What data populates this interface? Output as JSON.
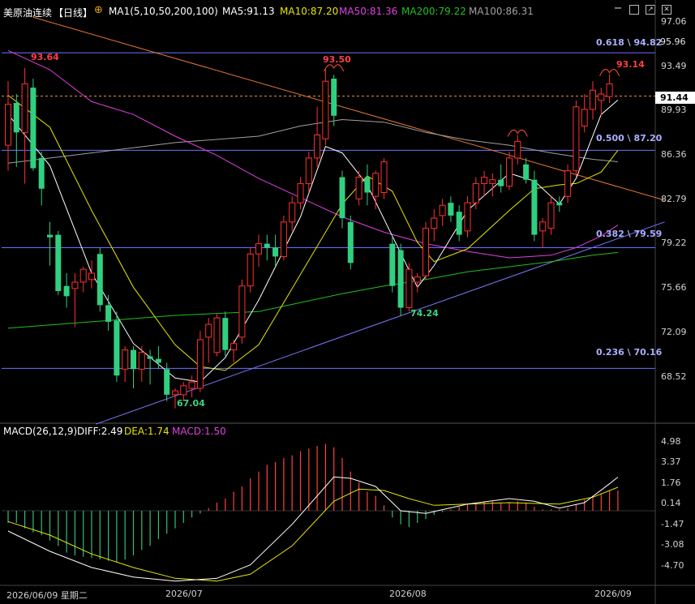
{
  "header": {
    "title": "美原油连续",
    "period": "【日线】",
    "ma_label": "MA1(5,10,50,200,100)",
    "ma5": "MA5:91.13",
    "ma10": "MA10:87.20",
    "ma50": "MA50:81.36",
    "ma200": "MA200:79.22",
    "ma100": "MA100:86.31",
    "colors": {
      "ma5": "#ffffff",
      "ma10": "#e6e600",
      "ma50": "#e040e0",
      "ma200": "#20c020",
      "ma100": "#a0a0a0"
    }
  },
  "macd_header": {
    "label": "MACD(26,12,9)",
    "diff": "DIFF:2.49",
    "dea": "DEA:1.74",
    "macd": "MACD:1.50"
  },
  "price_axis": [
    "97.06",
    "95.96",
    "93.49",
    "89.93",
    "86.36",
    "82.79",
    "79.22",
    "75.66",
    "72.09",
    "68.52"
  ],
  "price_tags": {
    "last": "91.44",
    "prev": "95.96"
  },
  "macd_axis": [
    "4.98",
    "3.37",
    "1.76",
    "0.14",
    "-1.47",
    "-3.08",
    "-4.70"
  ],
  "x_axis": [
    "2026/06/09 星期二",
    "2026/07",
    "2026/08",
    "2026/09"
  ],
  "annotations": {
    "high1": "93.64",
    "high2": "93.50",
    "high3": "93.14",
    "low1": "67.04",
    "low2": "74.24"
  },
  "fib_levels": [
    {
      "label": "0.618 \\ 94.82",
      "value": 94.82
    },
    {
      "label": "0.500 \\ 87.20",
      "value": 87.2
    },
    {
      "label": "0.382 \\ 79.59",
      "value": 79.59
    },
    {
      "label": "0.236 \\ 70.16",
      "value": 70.16
    }
  ],
  "chart_data": {
    "type": "candlestick",
    "title": "美原油连续【日线】",
    "ylim": [
      66.0,
      97.3
    ],
    "candles": [
      {
        "o": 87.6,
        "h": 92.6,
        "l": 85.6,
        "c": 90.8
      },
      {
        "o": 90.9,
        "h": 91.6,
        "l": 85.9,
        "c": 88.6
      },
      {
        "o": 88.6,
        "h": 93.64,
        "l": 84.6,
        "c": 92.4
      },
      {
        "o": 92.1,
        "h": 92.8,
        "l": 85.6,
        "c": 85.8
      },
      {
        "o": 86.6,
        "h": 87.1,
        "l": 82.9,
        "c": 84.2
      },
      {
        "o": 80.6,
        "h": 81.6,
        "l": 78.2,
        "c": 80.4
      },
      {
        "o": 80.6,
        "h": 80.9,
        "l": 75.9,
        "c": 76.2
      },
      {
        "o": 76.6,
        "h": 77.6,
        "l": 74.9,
        "c": 75.8
      },
      {
        "o": 76.4,
        "h": 77.6,
        "l": 73.4,
        "c": 76.9
      },
      {
        "o": 76.9,
        "h": 78.1,
        "l": 76.1,
        "c": 77.9
      },
      {
        "o": 77.1,
        "h": 78.6,
        "l": 76.4,
        "c": 77.6
      },
      {
        "o": 79.1,
        "h": 79.6,
        "l": 74.6,
        "c": 75.1
      },
      {
        "o": 75.1,
        "h": 75.9,
        "l": 73.1,
        "c": 73.8
      },
      {
        "o": 73.9,
        "h": 74.6,
        "l": 69.1,
        "c": 69.6
      },
      {
        "o": 70.1,
        "h": 71.9,
        "l": 69.1,
        "c": 71.6
      },
      {
        "o": 71.6,
        "h": 71.9,
        "l": 68.6,
        "c": 70.1
      },
      {
        "o": 70.1,
        "h": 71.9,
        "l": 69.1,
        "c": 71.4
      },
      {
        "o": 71.1,
        "h": 71.6,
        "l": 68.9,
        "c": 70.9
      },
      {
        "o": 70.9,
        "h": 71.9,
        "l": 70.1,
        "c": 70.6
      },
      {
        "o": 70.1,
        "h": 70.6,
        "l": 67.6,
        "c": 68.1
      },
      {
        "o": 68.1,
        "h": 68.6,
        "l": 67.04,
        "c": 68.4
      },
      {
        "o": 68.1,
        "h": 69.1,
        "l": 67.6,
        "c": 68.8
      },
      {
        "o": 68.6,
        "h": 69.6,
        "l": 67.9,
        "c": 69.1
      },
      {
        "o": 68.6,
        "h": 73.1,
        "l": 68.3,
        "c": 72.4
      },
      {
        "o": 72.6,
        "h": 74.1,
        "l": 70.6,
        "c": 73.6
      },
      {
        "o": 71.4,
        "h": 74.4,
        "l": 71.1,
        "c": 74.1
      },
      {
        "o": 74.1,
        "h": 74.6,
        "l": 71.1,
        "c": 71.6
      },
      {
        "o": 71.6,
        "h": 72.4,
        "l": 70.6,
        "c": 72.1
      },
      {
        "o": 72.6,
        "h": 77.1,
        "l": 72.1,
        "c": 76.6
      },
      {
        "o": 76.6,
        "h": 79.6,
        "l": 76.1,
        "c": 79.1
      },
      {
        "o": 79.1,
        "h": 80.6,
        "l": 78.1,
        "c": 79.9
      },
      {
        "o": 79.9,
        "h": 80.6,
        "l": 78.6,
        "c": 79.6
      },
      {
        "o": 79.6,
        "h": 80.6,
        "l": 78.1,
        "c": 78.9
      },
      {
        "o": 78.9,
        "h": 82.1,
        "l": 78.6,
        "c": 81.6
      },
      {
        "o": 81.6,
        "h": 83.6,
        "l": 80.9,
        "c": 83.1
      },
      {
        "o": 83.1,
        "h": 85.1,
        "l": 82.6,
        "c": 84.6
      },
      {
        "o": 84.6,
        "h": 87.1,
        "l": 83.9,
        "c": 86.6
      },
      {
        "o": 86.6,
        "h": 90.6,
        "l": 85.9,
        "c": 88.4
      },
      {
        "o": 88.1,
        "h": 93.5,
        "l": 87.6,
        "c": 92.6
      },
      {
        "o": 92.8,
        "h": 93.1,
        "l": 89.1,
        "c": 89.9
      },
      {
        "o": 85.1,
        "h": 85.6,
        "l": 81.1,
        "c": 81.9
      },
      {
        "o": 81.6,
        "h": 82.1,
        "l": 77.9,
        "c": 78.4
      },
      {
        "o": 83.4,
        "h": 85.6,
        "l": 82.9,
        "c": 85.1
      },
      {
        "o": 85.1,
        "h": 86.1,
        "l": 82.9,
        "c": 83.9
      },
      {
        "o": 83.6,
        "h": 85.6,
        "l": 82.6,
        "c": 85.4
      },
      {
        "o": 83.9,
        "h": 86.6,
        "l": 83.4,
        "c": 86.3
      },
      {
        "o": 79.9,
        "h": 80.6,
        "l": 76.1,
        "c": 76.6
      },
      {
        "o": 79.4,
        "h": 79.9,
        "l": 74.24,
        "c": 74.9
      },
      {
        "o": 74.9,
        "h": 78.4,
        "l": 74.6,
        "c": 77.9
      },
      {
        "o": 76.9,
        "h": 77.6,
        "l": 76.1,
        "c": 77.3
      },
      {
        "o": 77.4,
        "h": 81.6,
        "l": 77.1,
        "c": 81.1
      },
      {
        "o": 81.1,
        "h": 82.6,
        "l": 80.1,
        "c": 81.9
      },
      {
        "o": 82.1,
        "h": 83.4,
        "l": 81.3,
        "c": 82.9
      },
      {
        "o": 83.1,
        "h": 83.6,
        "l": 81.6,
        "c": 82.1
      },
      {
        "o": 82.4,
        "h": 82.9,
        "l": 80.1,
        "c": 80.6
      },
      {
        "o": 80.9,
        "h": 83.6,
        "l": 80.4,
        "c": 83.1
      },
      {
        "o": 83.1,
        "h": 85.1,
        "l": 82.6,
        "c": 84.6
      },
      {
        "o": 84.6,
        "h": 85.6,
        "l": 83.6,
        "c": 85.1
      },
      {
        "o": 84.6,
        "h": 85.4,
        "l": 83.6,
        "c": 84.9
      },
      {
        "o": 84.9,
        "h": 86.1,
        "l": 83.9,
        "c": 84.4
      },
      {
        "o": 84.4,
        "h": 87.1,
        "l": 84.1,
        "c": 86.6
      },
      {
        "o": 86.6,
        "h": 88.4,
        "l": 86.1,
        "c": 87.9
      },
      {
        "o": 86.1,
        "h": 86.6,
        "l": 84.6,
        "c": 84.9
      },
      {
        "o": 84.9,
        "h": 85.6,
        "l": 80.1,
        "c": 80.6
      },
      {
        "o": 80.9,
        "h": 81.9,
        "l": 79.6,
        "c": 81.6
      },
      {
        "o": 81.1,
        "h": 83.6,
        "l": 80.6,
        "c": 83.1
      },
      {
        "o": 83.1,
        "h": 83.6,
        "l": 82.4,
        "c": 82.9
      },
      {
        "o": 83.6,
        "h": 86.1,
        "l": 83.1,
        "c": 85.6
      },
      {
        "o": 85.6,
        "h": 91.1,
        "l": 85.1,
        "c": 90.6
      },
      {
        "o": 89.1,
        "h": 91.6,
        "l": 88.6,
        "c": 90.4
      },
      {
        "o": 90.4,
        "h": 92.6,
        "l": 89.6,
        "c": 91.9
      },
      {
        "o": 91.1,
        "h": 92.1,
        "l": 89.9,
        "c": 91.6
      },
      {
        "o": 91.4,
        "h": 93.14,
        "l": 90.9,
        "c": 92.4
      }
    ],
    "ma5": [
      [
        0,
        90.0
      ],
      [
        5,
        86.0
      ],
      [
        10,
        77.6
      ],
      [
        15,
        72.1
      ],
      [
        20,
        69.4
      ],
      [
        23,
        69.1
      ],
      [
        26,
        71.0
      ],
      [
        30,
        75.5
      ],
      [
        35,
        82.0
      ],
      [
        38,
        87.5
      ],
      [
        40,
        87.0
      ],
      [
        43,
        84.5
      ],
      [
        46,
        80.5
      ],
      [
        49,
        76.5
      ],
      [
        51,
        78.2
      ],
      [
        55,
        82.5
      ],
      [
        60,
        85.4
      ],
      [
        63,
        84.8
      ],
      [
        66,
        83.0
      ],
      [
        68,
        85.0
      ],
      [
        71,
        90.0
      ],
      [
        73,
        91.13
      ]
    ],
    "ma10": [
      [
        0,
        91.5
      ],
      [
        5,
        89.0
      ],
      [
        10,
        82.5
      ],
      [
        15,
        76.5
      ],
      [
        20,
        72.0
      ],
      [
        23,
        70.3
      ],
      [
        26,
        70.0
      ],
      [
        30,
        72.0
      ],
      [
        35,
        77.5
      ],
      [
        40,
        83.0
      ],
      [
        43,
        85.2
      ],
      [
        46,
        84.0
      ],
      [
        49,
        80.0
      ],
      [
        51,
        78.5
      ],
      [
        55,
        79.5
      ],
      [
        60,
        82.5
      ],
      [
        63,
        84.2
      ],
      [
        66,
        84.5
      ],
      [
        68,
        84.6
      ],
      [
        71,
        85.5
      ],
      [
        73,
        87.2
      ]
    ],
    "ma50": [
      [
        0,
        95.0
      ],
      [
        5,
        93.5
      ],
      [
        10,
        91.0
      ],
      [
        15,
        90.0
      ],
      [
        20,
        88.3
      ],
      [
        25,
        86.8
      ],
      [
        30,
        85.0
      ],
      [
        35,
        83.5
      ],
      [
        40,
        82.0
      ],
      [
        45,
        80.8
      ],
      [
        50,
        79.9
      ],
      [
        55,
        79.3
      ],
      [
        60,
        78.8
      ],
      [
        65,
        79.0
      ],
      [
        68,
        79.6
      ],
      [
        71,
        80.5
      ],
      [
        73,
        81.36
      ]
    ],
    "ma100": [
      [
        0,
        86.2
      ],
      [
        10,
        87.0
      ],
      [
        20,
        87.8
      ],
      [
        30,
        88.3
      ],
      [
        35,
        89.1
      ],
      [
        40,
        89.6
      ],
      [
        45,
        89.4
      ],
      [
        50,
        88.6
      ],
      [
        55,
        88.0
      ],
      [
        60,
        87.6
      ],
      [
        65,
        87.0
      ],
      [
        70,
        86.5
      ],
      [
        73,
        86.31
      ]
    ],
    "ma200": [
      [
        0,
        73.3
      ],
      [
        10,
        73.8
      ],
      [
        20,
        74.3
      ],
      [
        30,
        74.6
      ],
      [
        35,
        75.3
      ],
      [
        40,
        76.0
      ],
      [
        45,
        76.6
      ],
      [
        50,
        77.1
      ],
      [
        55,
        77.7
      ],
      [
        60,
        78.1
      ],
      [
        65,
        78.5
      ],
      [
        70,
        79.0
      ],
      [
        73,
        79.22
      ]
    ],
    "trendlines": [
      {
        "color": "#7878ff",
        "from": [
          10.5,
          65.8
        ],
        "to": [
          78.6,
          81.6
        ]
      },
      {
        "color": "#e87830",
        "from": [
          3.0,
          97.6
        ],
        "to": [
          78.6,
          83.3
        ]
      }
    ],
    "prev_close_line": 91.44,
    "macd_ylim": [
      -5.4,
      5.4
    ],
    "macd_hist": [
      -0.9,
      -0.9,
      -1.3,
      -1.6,
      -1.8,
      -2.2,
      -2.6,
      -3.1,
      -3.3,
      -3.4,
      -3.5,
      -3.6,
      -3.7,
      -3.8,
      -3.6,
      -3.3,
      -2.9,
      -2.6,
      -2.1,
      -1.7,
      -1.3,
      -0.9,
      -0.5,
      -0.2,
      0.2,
      0.6,
      0.9,
      1.4,
      1.8,
      2.4,
      2.9,
      3.4,
      3.6,
      3.9,
      4.1,
      4.4,
      4.6,
      4.8,
      4.95,
      4.7,
      3.9,
      2.9,
      2.1,
      1.4,
      1.1,
      0.4,
      -0.5,
      -1.0,
      -1.2,
      -0.9,
      -0.6,
      -0.3,
      -0.1,
      0.1,
      0.3,
      0.5,
      0.6,
      0.7,
      0.7,
      0.6,
      0.6,
      0.7,
      0.6,
      0.3,
      0.1,
      0.1,
      0.1,
      0.2,
      0.5,
      0.8,
      1.1,
      1.3,
      1.5,
      1.5
    ],
    "macd_diff": [
      [
        0,
        -1.5
      ],
      [
        5,
        -3.0
      ],
      [
        10,
        -4.2
      ],
      [
        15,
        -4.9
      ],
      [
        20,
        -5.2
      ],
      [
        25,
        -5.0
      ],
      [
        29,
        -4.0
      ],
      [
        34,
        -1.0
      ],
      [
        39,
        2.5
      ],
      [
        41,
        2.4
      ],
      [
        44,
        1.8
      ],
      [
        47,
        0.0
      ],
      [
        50,
        -0.2
      ],
      [
        55,
        0.5
      ],
      [
        60,
        0.9
      ],
      [
        63,
        0.7
      ],
      [
        66,
        0.2
      ],
      [
        69,
        0.6
      ],
      [
        72,
        2.0
      ],
      [
        73,
        2.49
      ]
    ],
    "macd_dea": [
      [
        0,
        -0.8
      ],
      [
        5,
        -1.8
      ],
      [
        10,
        -3.2
      ],
      [
        15,
        -4.2
      ],
      [
        20,
        -5.0
      ],
      [
        25,
        -5.2
      ],
      [
        29,
        -4.7
      ],
      [
        34,
        -2.6
      ],
      [
        39,
        0.7
      ],
      [
        42,
        1.6
      ],
      [
        45,
        1.5
      ],
      [
        48,
        0.9
      ],
      [
        51,
        0.4
      ],
      [
        55,
        0.5
      ],
      [
        60,
        0.6
      ],
      [
        66,
        0.5
      ],
      [
        70,
        1.0
      ],
      [
        73,
        1.74
      ]
    ]
  }
}
